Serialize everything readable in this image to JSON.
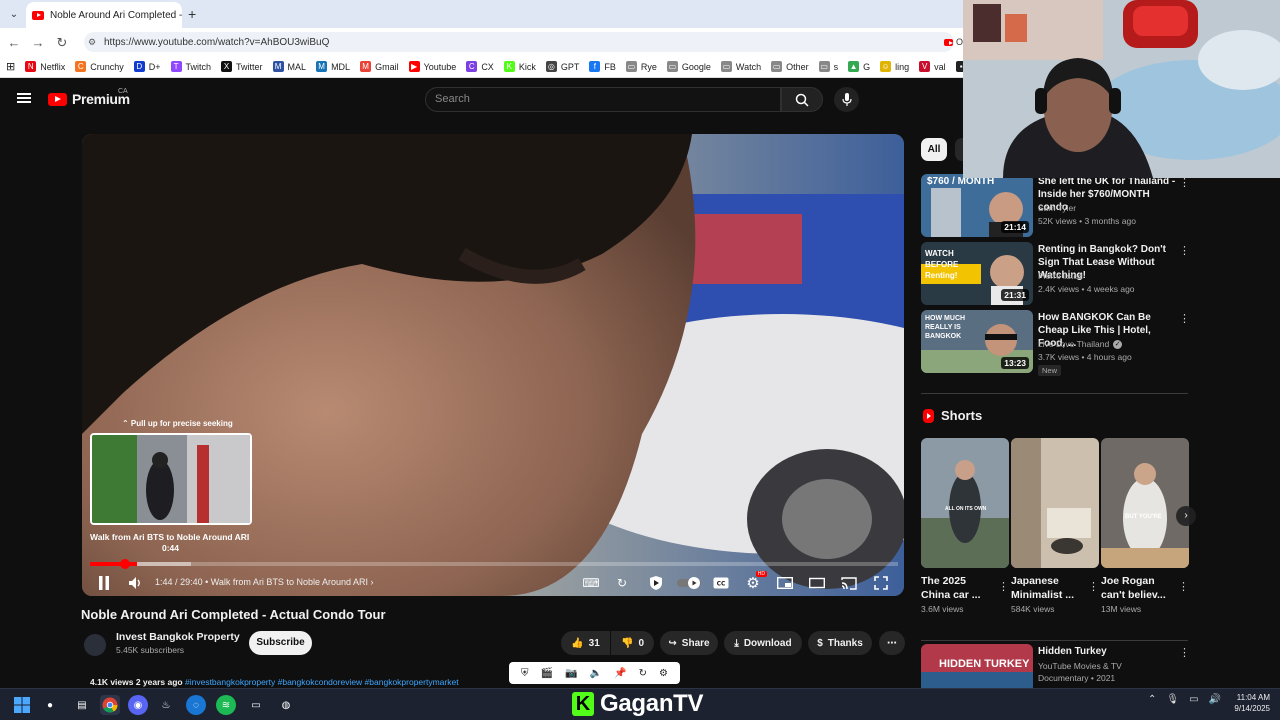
{
  "browser": {
    "tab_title": "Noble Around Ari Completed - Actual Condo Tour",
    "new_tab": "+",
    "url": "https://www.youtube.com/watch?v=AhBOU3wiBuQ",
    "url_indicator": "O",
    "bookmarks": [
      {
        "label": "Netflix",
        "color": "#e50914",
        "glyph": "N"
      },
      {
        "label": "Crunchy",
        "color": "#f47521",
        "glyph": "C"
      },
      {
        "label": "D+",
        "color": "#113ccf",
        "glyph": "D"
      },
      {
        "label": "Twitch",
        "color": "#9146ff",
        "glyph": "T"
      },
      {
        "label": "Twitter",
        "color": "#111111",
        "glyph": "X"
      },
      {
        "label": "MAL",
        "color": "#2e51a2",
        "glyph": "M"
      },
      {
        "label": "MDL",
        "color": "#1675b6",
        "glyph": "M"
      },
      {
        "label": "Gmail",
        "color": "#ea4335",
        "glyph": "M"
      },
      {
        "label": "Youtube",
        "color": "#ff0000",
        "glyph": "▶"
      },
      {
        "label": "CX",
        "color": "#7b3fe4",
        "glyph": "C"
      },
      {
        "label": "Kick",
        "color": "#53fc18",
        "glyph": "K"
      },
      {
        "label": "GPT",
        "color": "#444444",
        "glyph": "◎"
      },
      {
        "label": "FB",
        "color": "#1877f2",
        "glyph": "f"
      },
      {
        "label": "Rye",
        "color": "#888888",
        "glyph": "▭"
      },
      {
        "label": "Google",
        "color": "#888888",
        "glyph": "▭"
      },
      {
        "label": "Watch",
        "color": "#888888",
        "glyph": "▭"
      },
      {
        "label": "Other",
        "color": "#888888",
        "glyph": "▭"
      },
      {
        "label": "s",
        "color": "#888888",
        "glyph": "▭"
      },
      {
        "label": "G",
        "color": "#34a853",
        "glyph": "▲"
      },
      {
        "label": "ling",
        "color": "#e0b400",
        "glyph": "☺"
      },
      {
        "label": "val",
        "color": "#c8102e",
        "glyph": "V"
      },
      {
        "label": "1",
        "color": "#222222",
        "glyph": "▪"
      }
    ]
  },
  "masthead": {
    "logo_text": "Premium",
    "region": "CA",
    "search_placeholder": "Search"
  },
  "player": {
    "preview_hint": "⌃ Pull up for precise seeking",
    "preview_chapter": "Walk from Ari BTS to Noble Around ARI",
    "preview_time": "0:44",
    "current_time": "1:44",
    "duration": "29:40",
    "chapter": "Walk from Ari BTS to Noble Around ARI",
    "played_fraction": 0.058,
    "buffered_fraction": 0.125,
    "hover_fraction": 0.025,
    "settings_badge": "HD"
  },
  "video": {
    "title": "Noble Around Ari Completed - Actual Condo Tour",
    "channel": "Invest Bangkok Property",
    "subscribers": "5.45K subscribers",
    "subscribe_label": "Subscribe",
    "likes": "31",
    "dislikes": "0",
    "share_label": "Share",
    "download_label": "Download",
    "thanks_label": "Thanks",
    "views_date": "4.1K views  2 years ago",
    "hashtags": "#investbangkokproperty #bangkokcondoreview #bangkokpropertymarket"
  },
  "sidebar": {
    "chip_all": "All",
    "recommendations": [
      {
        "title": "She left the UK for Thailand - Inside her $760/MONTH condo",
        "channel": "Sam Tyler",
        "verified": false,
        "meta": "52K views • 3 months ago",
        "duration": "21:14",
        "thumb_text": "$760 / MONTH",
        "is_new": ""
      },
      {
        "title": "Renting in Bangkok? Don't Sign That Lease Without Watching!",
        "channel": "Pierre listed",
        "verified": false,
        "meta": "2.4K views • 4 weeks ago",
        "duration": "21:31",
        "thumb_text": "WATCH BEFORE Renting!",
        "is_new": ""
      },
      {
        "title": "How BANGKOK Can Be Cheap Like This | Hotel, Food, ...",
        "channel": "Live Love Thailand",
        "verified": true,
        "meta": "3.7K views • 4 hours ago",
        "duration": "13:23",
        "thumb_text": "HOW MUCH REALLY IS BANGKOK",
        "is_new": "New"
      }
    ],
    "shorts_label": "Shorts",
    "shorts": [
      {
        "title": "The 2025 China car ...",
        "views": "3.6M views",
        "thumb_text": "ALL ON ITS OWN"
      },
      {
        "title": "Japanese Minimalist ...",
        "views": "584K views",
        "thumb_text": ""
      },
      {
        "title": "Joe Rogan can't believ...",
        "views": "13M views",
        "thumb_text": "BUT YOU'RE"
      }
    ],
    "last": {
      "title": "Hidden Turkey",
      "channel": "YouTube Movies & TV",
      "meta": "Documentary • 2021",
      "thumb_text": "HIDDEN TURKEY"
    }
  },
  "overlay": {
    "brand": "GaganTV",
    "brand_mark": "K"
  },
  "taskbar": {
    "time": "11:04 AM",
    "date": "9/14/2025"
  },
  "colors": {
    "yt_red": "#ff0000",
    "bg": "#0f0f0f",
    "kick_green": "#53fc18"
  }
}
